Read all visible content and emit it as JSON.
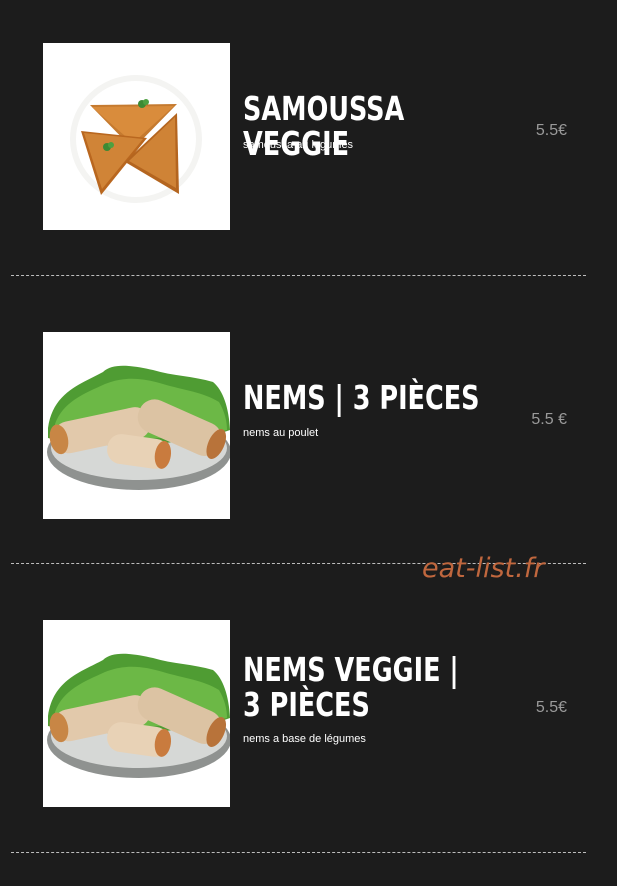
{
  "menu": {
    "items": [
      {
        "name": "SAMOUSSA VEGGIE",
        "description": "samoussa au legumes",
        "price": "5.5€",
        "image": "samosa-plate"
      },
      {
        "name": "NEMS | 3 PIÈCES",
        "description": "nems au poulet",
        "price": "5.5 €",
        "image": "spring-rolls-plate"
      },
      {
        "name": "NEMS VEGGIE | 3 PIÈCES",
        "description": "nems a base de légumes",
        "price": "5.5€",
        "image": "spring-rolls-plate"
      }
    ]
  },
  "watermark": "eat-list.fr",
  "colors": {
    "background": "#1c1c1c",
    "title": "#ffffff",
    "price": "#9a9a9a",
    "watermark": "#c0673e",
    "separator": "#bdbdbd"
  }
}
